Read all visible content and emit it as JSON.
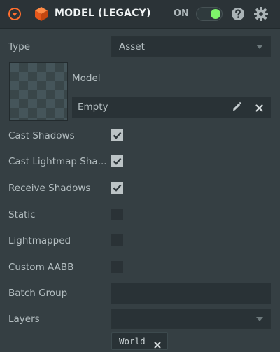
{
  "header": {
    "title": "MODEL (LEGACY)",
    "enabled_label": "ON",
    "enabled": true,
    "accent_color": "#ff6e2e",
    "toggle_color": "#7ef56a",
    "icons": [
      "collapse-icon",
      "model-cube-icon",
      "help-icon",
      "gear-icon"
    ]
  },
  "fields": {
    "type": {
      "label": "Type",
      "value": "Asset"
    },
    "model": {
      "label": "Model",
      "value": "Empty"
    },
    "cast_shadows": {
      "label": "Cast Shadows",
      "checked": true
    },
    "cast_lightmap_shadows": {
      "label": "Cast Lightmap Sha...",
      "checked": true
    },
    "receive_shadows": {
      "label": "Receive Shadows",
      "checked": true
    },
    "static": {
      "label": "Static",
      "checked": false
    },
    "lightmapped": {
      "label": "Lightmapped",
      "checked": false
    },
    "custom_aabb": {
      "label": "Custom AABB",
      "checked": false
    },
    "batch_group": {
      "label": "Batch Group",
      "value": ""
    },
    "layers": {
      "label": "Layers",
      "value": "",
      "tags": [
        "World"
      ]
    }
  }
}
